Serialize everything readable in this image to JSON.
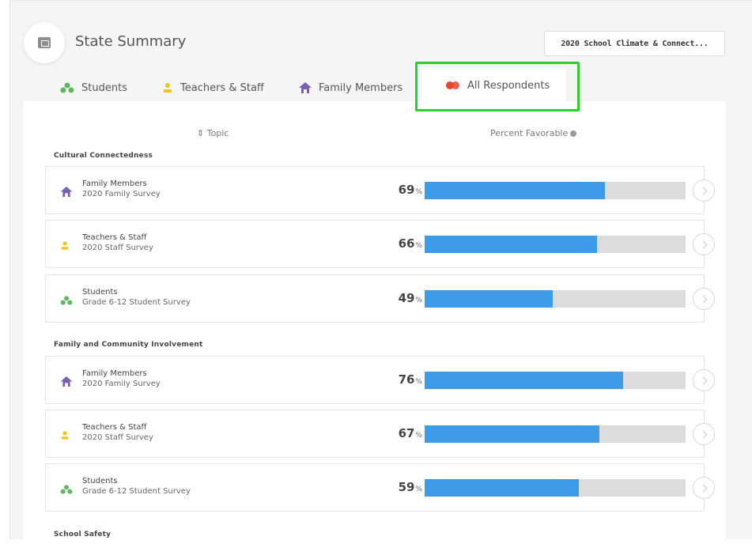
{
  "header": {
    "title": "State Summary",
    "survey_select": "2020 School Climate & Connect..."
  },
  "tabs": [
    {
      "label": "Students",
      "icon": "students-icon",
      "color": "#5cb85c"
    },
    {
      "label": "Teachers & Staff",
      "icon": "teacher-icon",
      "color": "#f0c419"
    },
    {
      "label": "Family Members",
      "icon": "home-icon",
      "color": "#7a5fb5"
    },
    {
      "label": "All Respondents",
      "icon": "all-respondents-icon",
      "color": "#e8452c",
      "active": true
    }
  ],
  "table": {
    "topic_header": "⇕ Topic",
    "percent_header": "Percent Favorable"
  },
  "sections": [
    {
      "label": "Cultural Connectedness",
      "rows": [
        {
          "group": "Family Members",
          "survey": "2020 Family Survey",
          "value": 69,
          "icon": "home-icon"
        },
        {
          "group": "Teachers & Staff",
          "survey": "2020 Staff Survey",
          "value": 66,
          "icon": "teacher-icon"
        },
        {
          "group": "Students",
          "survey": "Grade 6-12 Student Survey",
          "value": 49,
          "icon": "students-icon"
        }
      ]
    },
    {
      "label": "Family and Community Involvement",
      "rows": [
        {
          "group": "Family Members",
          "survey": "2020 Family Survey",
          "value": 76,
          "icon": "home-icon"
        },
        {
          "group": "Teachers & Staff",
          "survey": "2020 Staff Survey",
          "value": 67,
          "icon": "teacher-icon"
        },
        {
          "group": "Students",
          "survey": "Grade 6-12 Student Survey",
          "value": 59,
          "icon": "students-icon"
        }
      ]
    },
    {
      "label": "School Safety",
      "rows": []
    }
  ],
  "percent_suffix": "%",
  "colors": {
    "bar": "#3d9be9",
    "track": "#dcdcdc",
    "highlight": "#2bd12b"
  }
}
